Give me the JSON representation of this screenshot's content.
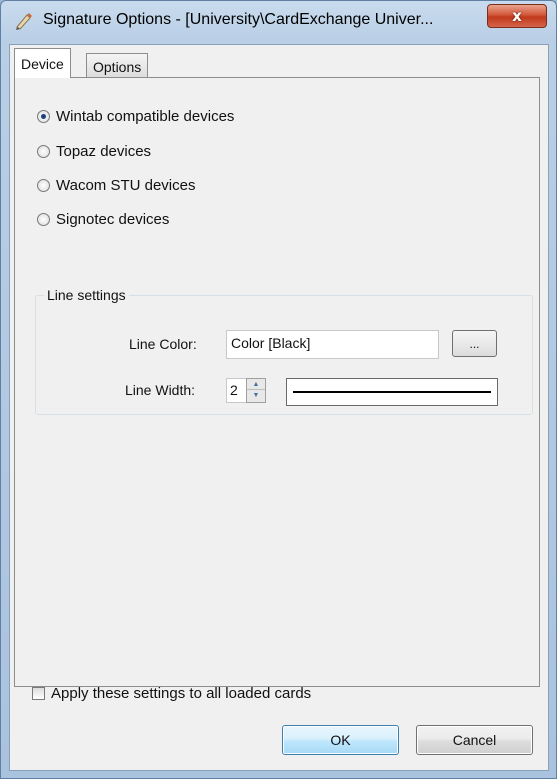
{
  "window": {
    "title": "Signature Options - [University\\CardExchange Univer...",
    "close_label": "x"
  },
  "tabs": [
    {
      "label": "Device",
      "active": true
    },
    {
      "label": "Options",
      "active": false
    }
  ],
  "devices": [
    {
      "label": "Wintab compatible devices",
      "checked": true
    },
    {
      "label": "Topaz devices",
      "checked": false
    },
    {
      "label": "Wacom STU devices",
      "checked": false
    },
    {
      "label": "Signotec devices",
      "checked": false
    }
  ],
  "line_settings": {
    "title": "Line settings",
    "color_label": "Line Color:",
    "color_value": "Color [Black]",
    "browse_label": "...",
    "width_label": "Line Width:",
    "width_value": "2",
    "line_color": "#000000"
  },
  "apply_all": {
    "label": "Apply these settings to all loaded cards",
    "checked": false
  },
  "buttons": {
    "ok": "OK",
    "cancel": "Cancel"
  },
  "colors": {
    "ok_border": "#3c7fb1",
    "close_red": "#c0391c",
    "dialog_bg": "#f0f0f0"
  }
}
